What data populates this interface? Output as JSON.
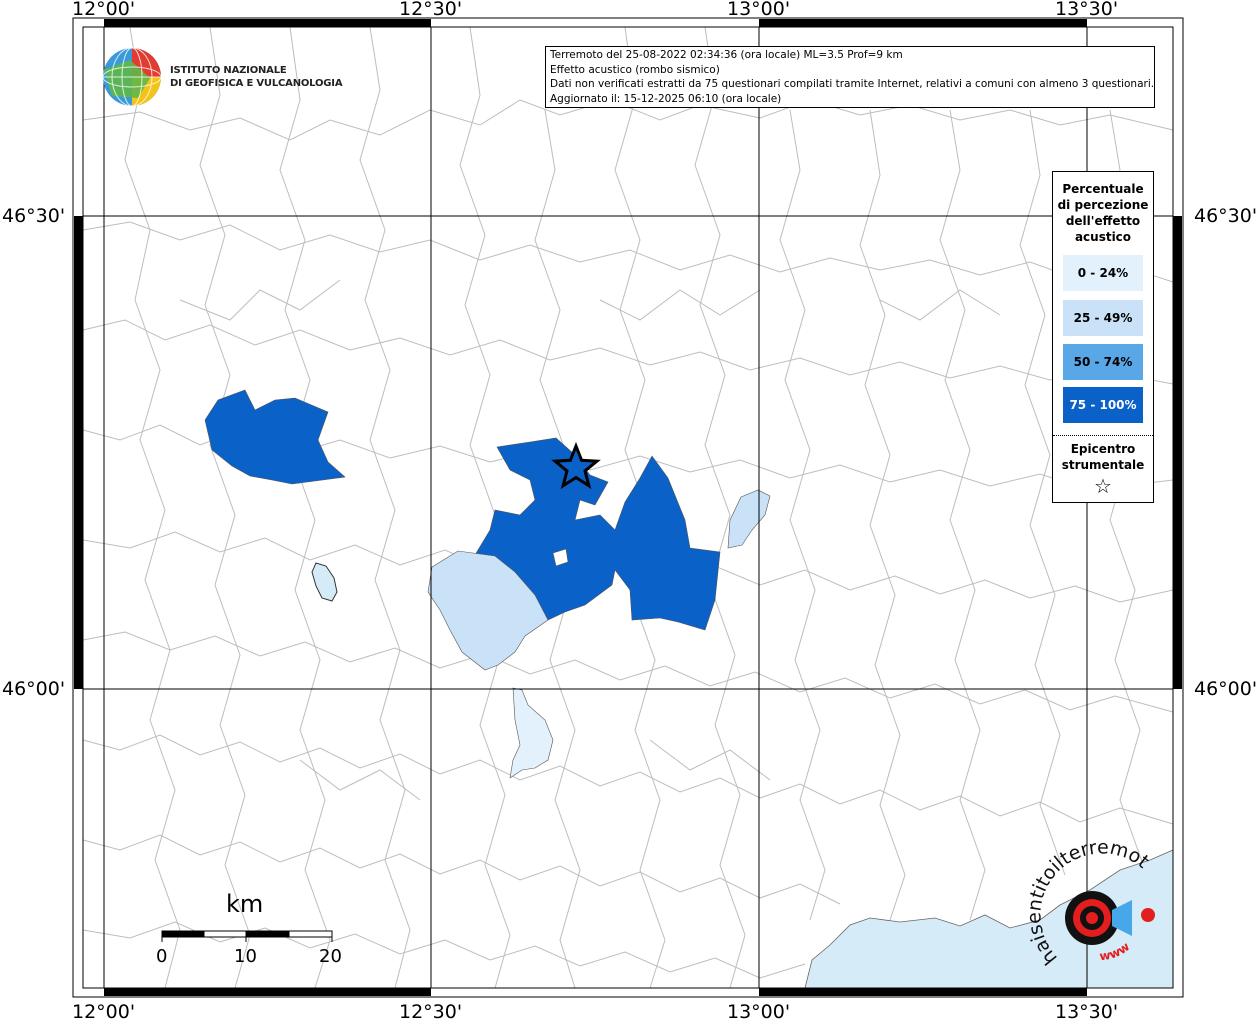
{
  "frame": {
    "top_labels": [
      "12°00'",
      "12°30'",
      "13°00'",
      "13°30'"
    ],
    "bottom_labels": [
      "12°00'",
      "12°30'",
      "13°00'",
      "13°30'"
    ],
    "left_labels": [
      "46°30'",
      "46°00'"
    ],
    "right_labels": [
      "46°30'",
      "46°00'"
    ]
  },
  "logo": {
    "line1": "ISTITUTO NAZIONALE",
    "line2": "DI GEOFISICA E VULCANOLOGIA"
  },
  "info": {
    "line1": "Terremoto del 25-08-2022 02:34:36 (ora locale) ML=3.5 Prof=9 km",
    "line2": "Effetto acustico (rombo sismico)",
    "line3": "Dati non verificati estratti da 75 questionari compilati tramite Internet, relativi a comuni con almeno 3 questionari.",
    "line4": "Aggiornato il: 15-12-2025 06:10 (ora locale)"
  },
  "legend": {
    "title_lines": [
      "Percentuale",
      "di percezione",
      "dell'effetto",
      "acustico"
    ],
    "classes": [
      {
        "label": "0 - 24%",
        "color": "#e3f1fc",
        "text_color": "#000000"
      },
      {
        "label": "25 - 49%",
        "color": "#c9e2f8",
        "text_color": "#000000"
      },
      {
        "label": "50 - 74%",
        "color": "#5aa7e8",
        "text_color": "#000000"
      },
      {
        "label": "75 - 100%",
        "color": "#0a61c8",
        "text_color": "#ffffff"
      }
    ],
    "epicenter_line1": "Epicentro",
    "epicenter_line2": "strumentale",
    "epicenter_symbol": "☆"
  },
  "scale": {
    "title": "km",
    "labels": [
      "0",
      "10",
      "20"
    ]
  },
  "watermark": {
    "text": "haisentitoilterremoto.it",
    "url": "www",
    "icon": "speaker-ear-logo"
  },
  "colors": {
    "high": "#0a61c8",
    "low": "#c9e2f8",
    "lowest": "#e3f1fc",
    "sea": "#d6ebf8",
    "border": "#b8b8b8"
  }
}
